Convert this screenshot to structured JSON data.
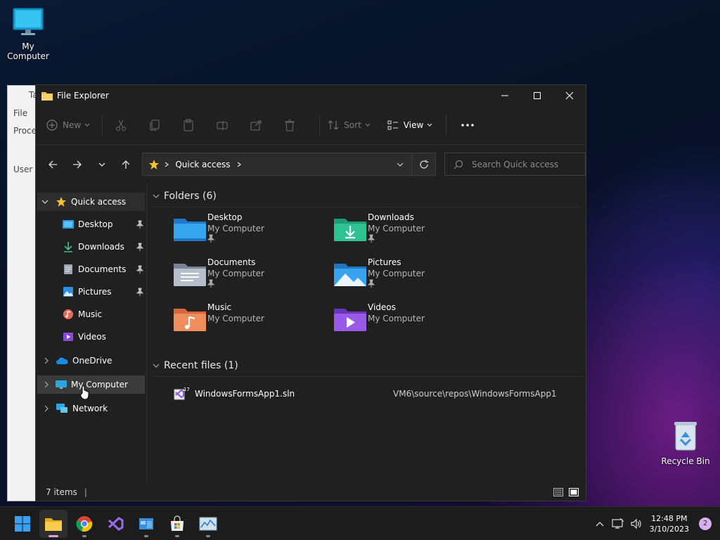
{
  "desktop": {
    "icons": [
      {
        "label": "My Computer",
        "icon": "monitor-icon"
      },
      {
        "label": "Recycle Bin",
        "icon": "recycle-bin-icon"
      }
    ]
  },
  "background_window": {
    "items": [
      "Ta",
      "File",
      "Proces",
      "User"
    ]
  },
  "window": {
    "title": "File Explorer",
    "controls": [
      "minimize",
      "maximize",
      "close"
    ]
  },
  "toolbar": {
    "new_label": "New",
    "sort_label": "Sort",
    "view_label": "View"
  },
  "address": {
    "crumb": "Quick access",
    "search_placeholder": "Search Quick access"
  },
  "nav": {
    "quick_access": "Quick access",
    "items": [
      {
        "label": "Desktop",
        "pinned": true
      },
      {
        "label": "Downloads",
        "pinned": true
      },
      {
        "label": "Documents",
        "pinned": true
      },
      {
        "label": "Pictures",
        "pinned": true
      },
      {
        "label": "Music",
        "pinned": false
      },
      {
        "label": "Videos",
        "pinned": false
      }
    ],
    "onedrive": "OneDrive",
    "my_computer": "My Computer",
    "network": "Network"
  },
  "folders": {
    "header": "Folders (6)",
    "items": [
      {
        "name": "Desktop",
        "location": "My Computer",
        "pinned": true
      },
      {
        "name": "Downloads",
        "location": "My Computer",
        "pinned": true
      },
      {
        "name": "Documents",
        "location": "My Computer",
        "pinned": true
      },
      {
        "name": "Pictures",
        "location": "My Computer",
        "pinned": true
      },
      {
        "name": "Music",
        "location": "My Computer",
        "pinned": false
      },
      {
        "name": "Videos",
        "location": "My Computer",
        "pinned": false
      }
    ]
  },
  "recent": {
    "header": "Recent files (1)",
    "files": [
      {
        "name": "WindowsFormsApp1.sln",
        "path": "VM6\\source\\repos\\WindowsFormsApp1"
      }
    ]
  },
  "status": {
    "items": "7 items"
  },
  "taskbar": {
    "time": "12:48 PM",
    "date": "3/10/2023",
    "notifications": "2"
  },
  "colors": {
    "folder_blue": "#2a8ad4",
    "folder_yellow": "#e8b84a",
    "accent_pink": "#e0a0d8"
  }
}
